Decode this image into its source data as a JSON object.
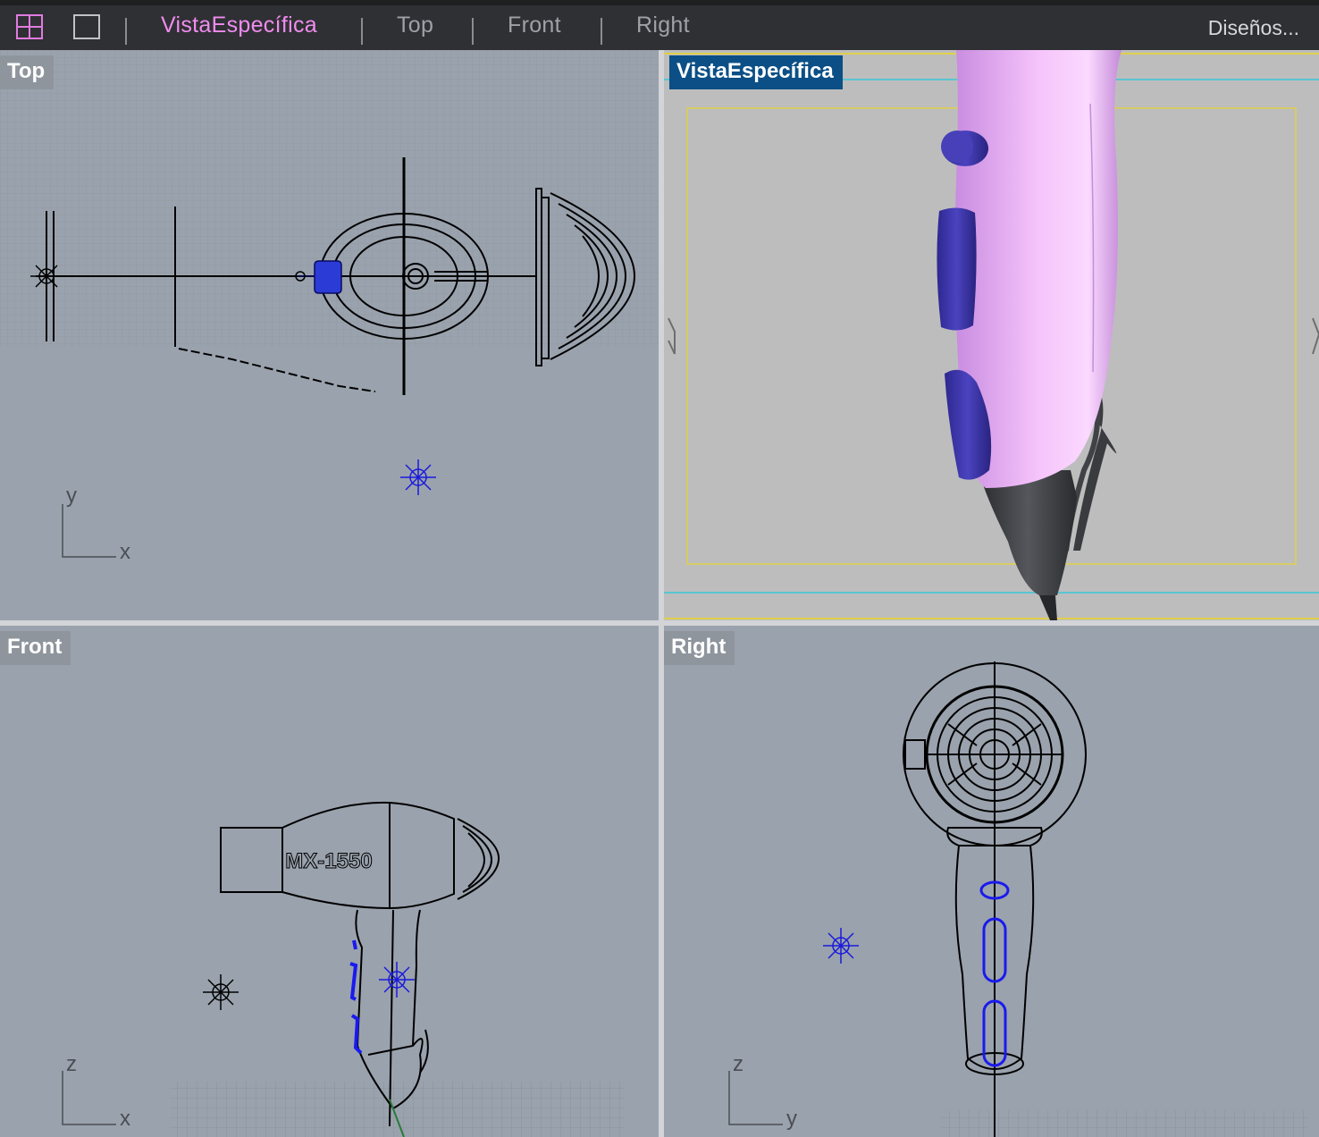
{
  "toolbar": {
    "grid_icon": "four-viewports-icon",
    "single_icon": "single-viewport-icon",
    "tabs": [
      {
        "label": "VistaEspecífica",
        "active": true
      },
      {
        "label": "Top",
        "active": false
      },
      {
        "label": "Front",
        "active": false
      },
      {
        "label": "Right",
        "active": false
      }
    ],
    "layouts_label": "Diseños..."
  },
  "viewports": {
    "top": {
      "label": "Top",
      "axis_v": "y",
      "axis_h": "x"
    },
    "perspective": {
      "label": "VistaEspecífica"
    },
    "front": {
      "label": "Front",
      "axis_v": "z",
      "axis_h": "x",
      "model_text": "MX-1550"
    },
    "right": {
      "label": "Right",
      "axis_v": "z",
      "axis_h": "y"
    }
  },
  "colors": {
    "active_tab": "#f08cf0",
    "active_viewport_label": "#0b4f86",
    "viewport_bg": "#9aa2ad",
    "perspective_bg": "#bdbdbd",
    "selection_blue": "#2222dd",
    "body_pink": "#e9a6f5",
    "button_purple": "#3f38a8"
  }
}
